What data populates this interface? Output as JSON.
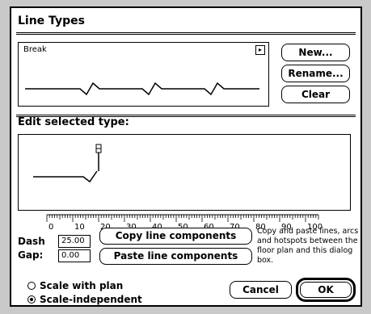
{
  "dialog": {
    "title": "Line Types",
    "edit_section_title": "Edit selected type:"
  },
  "line_type_list": {
    "selected_name": "Break",
    "popup_icon": "popup-arrow-icon"
  },
  "buttons": {
    "new": "New...",
    "rename": "Rename...",
    "clear": "Clear",
    "copy": "Copy line components",
    "paste": "Paste line components",
    "cancel": "Cancel",
    "ok": "OK"
  },
  "ruler": {
    "labels": [
      "0",
      "10",
      "20",
      "30",
      "40",
      "50",
      "60",
      "70",
      "80",
      "90",
      "100"
    ]
  },
  "fields": {
    "dash_label": "Dash",
    "dash_value": "25.00",
    "gap_label": "Gap:",
    "gap_value": "0.00"
  },
  "help_text": "Copy and paste lines, arcs and hotspots between the floor plan and this dialog box.",
  "scale_options": {
    "option1": "Scale with plan",
    "option2": "Scale-independent",
    "selected": "Scale-independent"
  }
}
